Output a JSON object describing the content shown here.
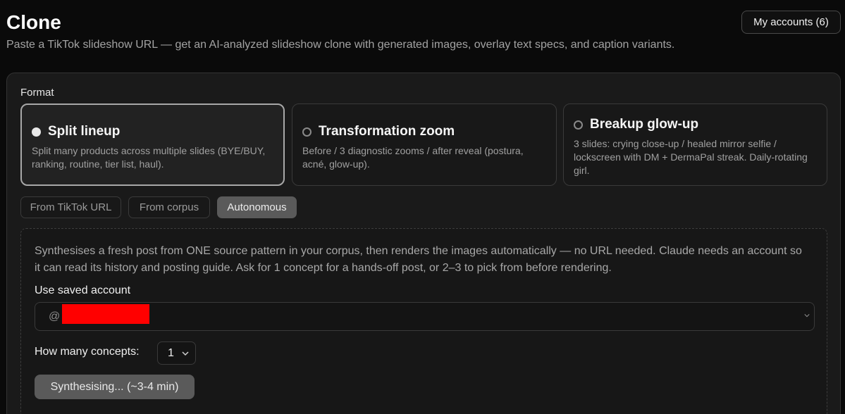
{
  "header": {
    "title": "Clone",
    "subtitle": "Paste a TikTok slideshow URL — get an AI-analyzed slideshow clone with generated images, overlay text specs, and caption variants.",
    "accounts_button": "My accounts (6)"
  },
  "format": {
    "label": "Format",
    "options": [
      {
        "title": "Split lineup",
        "description": "Split many products across multiple slides (BYE/BUY, ranking, routine, tier list, haul).",
        "selected": true
      },
      {
        "title": "Transformation zoom",
        "description": "Before / 3 diagnostic zooms / after reveal (postura, acné, glow-up).",
        "selected": false
      },
      {
        "title": "Breakup glow-up",
        "description": "3 slides: crying close-up / healed mirror selfie / lockscreen with DM + DermaPal streak. Daily-rotating girl.",
        "selected": false
      }
    ]
  },
  "source_tabs": [
    {
      "label": "From TikTok URL",
      "active": false
    },
    {
      "label": "From corpus",
      "active": false
    },
    {
      "label": "Autonomous",
      "active": true
    }
  ],
  "autonomous": {
    "description": "Synthesises a fresh post from ONE source pattern in your corpus, then renders the images automatically — no URL needed. Claude needs an account so it can read its history and posting guide. Ask for 1 concept for a hands-off post, or 2–3 to pick from before rendering.",
    "account_label": "Use saved account",
    "account_value_prefix": "@",
    "concepts_label": "How many concepts:",
    "concepts_value": "1",
    "synth_button": "Synthesising... (~3-4 min)"
  },
  "colors": {
    "background": "#0a0a0a",
    "panel": "#1a1a1a",
    "active_tab": "#5a5a5a",
    "redaction": "#ff0000"
  }
}
